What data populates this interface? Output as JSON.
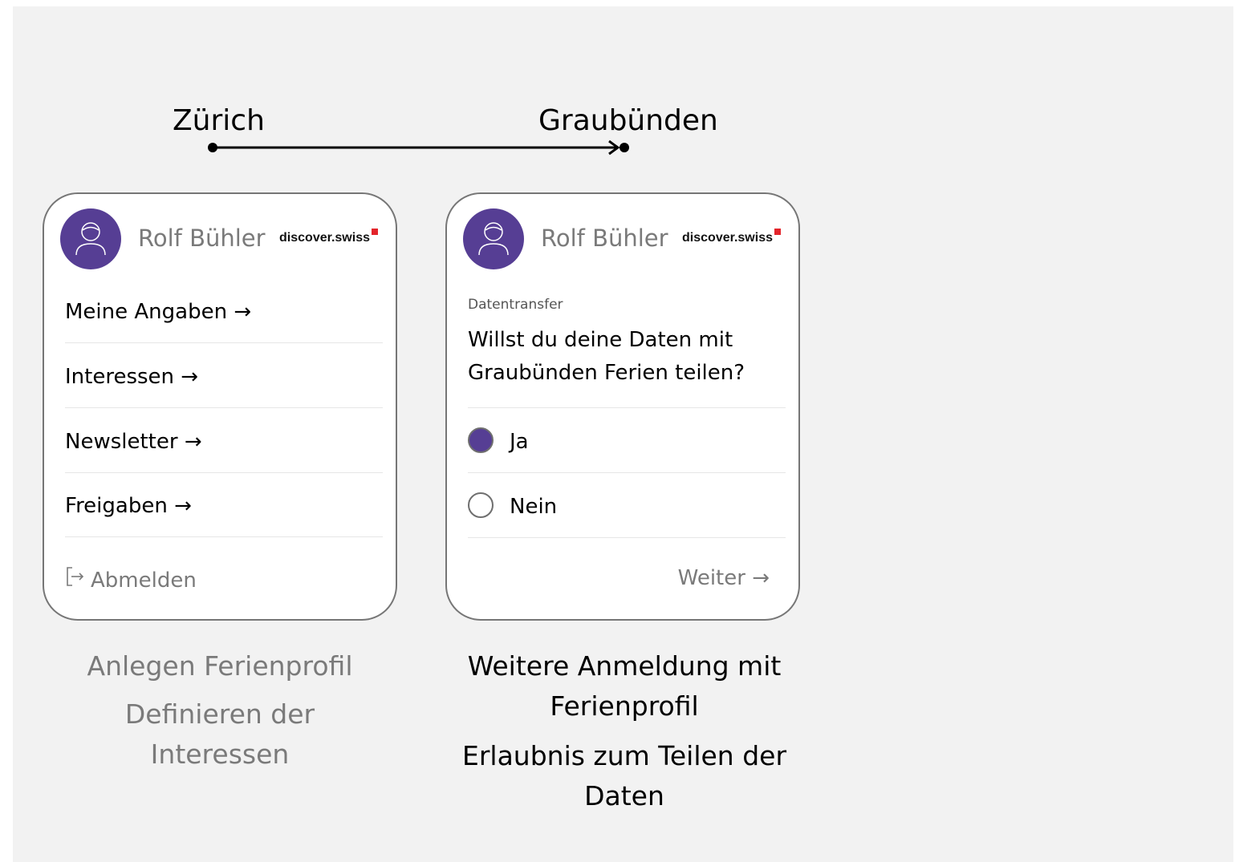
{
  "route": {
    "from": "Zürich",
    "to": "Graubünden"
  },
  "colors": {
    "accent": "#563e94",
    "muted": "#7a7a7a",
    "background": "#f2f2f2"
  },
  "card_profile": {
    "user_name": "Rolf Bühler",
    "brand": "discover.swiss",
    "menu": [
      {
        "label": "Meine Angaben →"
      },
      {
        "label": "Interessen →"
      },
      {
        "label": "Newsletter →"
      },
      {
        "label": "Freigaben →"
      }
    ],
    "logout_icon": "logout-icon",
    "logout_label": "Abmelden"
  },
  "card_transfer": {
    "user_name": "Rolf Bühler",
    "brand": "discover.swiss",
    "section_label": "Datentransfer",
    "question": "Willst du deine Daten mit Graubünden Ferien teilen?",
    "options": [
      {
        "label": "Ja",
        "selected": true
      },
      {
        "label": "Nein",
        "selected": false
      }
    ],
    "next_label": "Weiter →"
  },
  "captions": {
    "profile": {
      "title": "Anlegen Ferienprofil",
      "subtitle": "Definieren der Interessen"
    },
    "transfer": {
      "title": "Weitere Anmeldung mit Ferienprofil",
      "subtitle": "Erlaubnis zum Teilen der Daten"
    }
  }
}
